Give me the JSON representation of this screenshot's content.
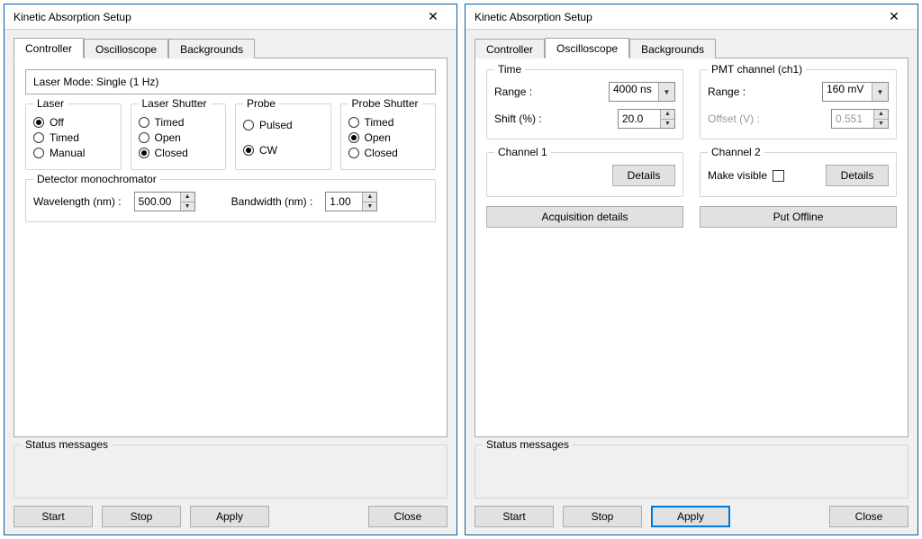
{
  "window_title": "Kinetic Absorption Setup",
  "tabs": {
    "controller": "Controller",
    "oscilloscope": "Oscilloscope",
    "backgrounds": "Backgrounds"
  },
  "controller": {
    "laser_mode": "Laser Mode: Single (1 Hz)",
    "groups": {
      "laser": "Laser",
      "laser_shutter": "Laser Shutter",
      "probe": "Probe",
      "probe_shutter": "Probe Shutter",
      "detector_mono": "Detector monochromator"
    },
    "laser_opts": {
      "off": "Off",
      "timed": "Timed",
      "manual": "Manual"
    },
    "laser_shutter_opts": {
      "timed": "Timed",
      "open": "Open",
      "closed": "Closed"
    },
    "probe_opts": {
      "pulsed": "Pulsed",
      "cw": "CW"
    },
    "probe_shutter_opts": {
      "timed": "Timed",
      "open": "Open",
      "closed": "Closed"
    },
    "wavelength_label": "Wavelength (nm) :",
    "wavelength_value": "500.00",
    "bandwidth_label": "Bandwidth (nm) :",
    "bandwidth_value": "1.00"
  },
  "oscilloscope": {
    "groups": {
      "time": "Time",
      "pmt": "PMT channel (ch1)",
      "ch1": "Channel 1",
      "ch2": "Channel 2"
    },
    "time_range_label": "Range :",
    "time_range_value": "4000 ns",
    "shift_label": "Shift (%) :",
    "shift_value": "20.0",
    "pmt_range_label": "Range :",
    "pmt_range_value": "160 mV",
    "offset_label": "Offset (V) :",
    "offset_value": "0.551",
    "details_label": "Details",
    "make_visible_label": "Make visible",
    "acq_details": "Acquisition details",
    "put_offline": "Put Offline"
  },
  "status_label": "Status messages",
  "buttons": {
    "start": "Start",
    "stop": "Stop",
    "apply": "Apply",
    "close": "Close"
  }
}
